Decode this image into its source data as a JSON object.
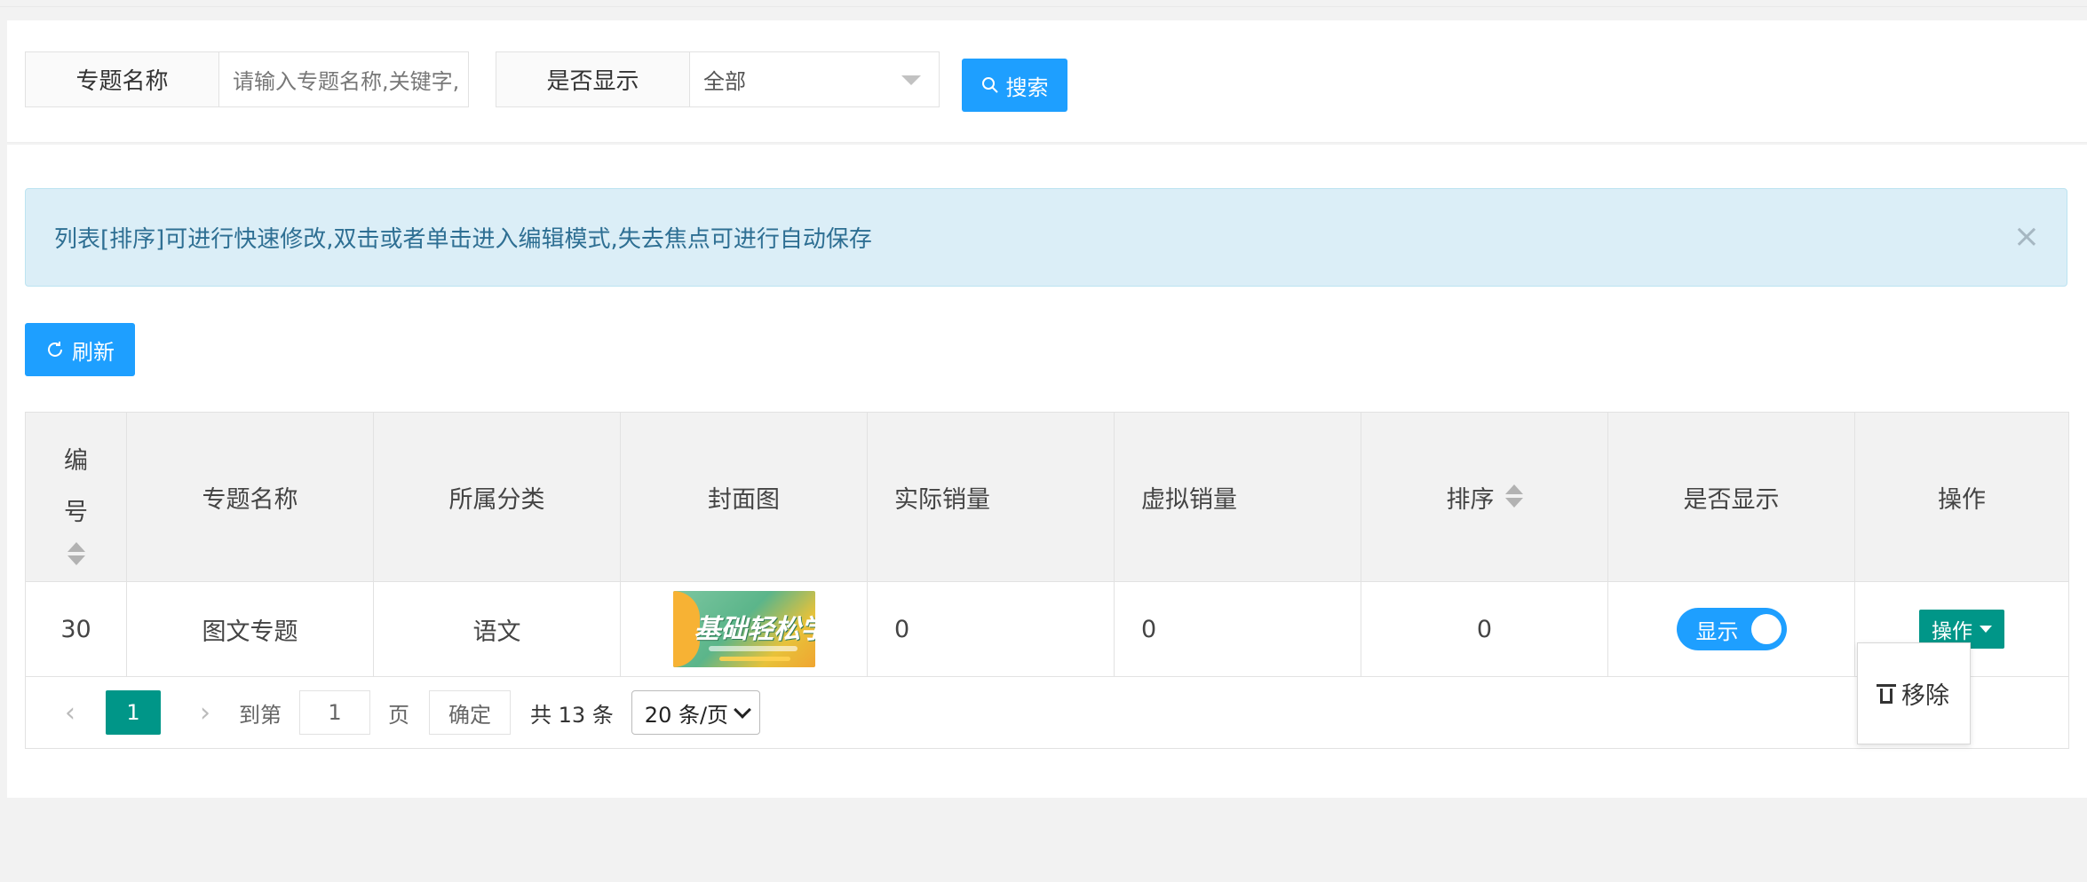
{
  "search": {
    "field1_label": "专题名称",
    "field1_placeholder": "请输入专题名称,关键字,",
    "field2_label": "是否显示",
    "field2_value": "全部",
    "search_button": "搜索"
  },
  "alert": {
    "text": "列表[排序]可进行快速修改,双击或者单击进入编辑模式,失去焦点可进行自动保存",
    "close": "×"
  },
  "toolbar": {
    "refresh_label": "刷新"
  },
  "table": {
    "headers": {
      "id_line1": "编",
      "id_line2": "号",
      "name": "专题名称",
      "category": "所属分类",
      "cover": "封面图",
      "actual_sales": "实际销量",
      "virtual_sales": "虚拟销量",
      "sort": "排序",
      "visible": "是否显示",
      "ops": "操作"
    },
    "rows": [
      {
        "id": "30",
        "name": "图文专题",
        "category": "语文",
        "cover_text": "基础轻松学",
        "actual_sales": "0",
        "virtual_sales": "0",
        "sort": "0",
        "visible_label": "显示",
        "ops_label": "操作"
      }
    ]
  },
  "pagination": {
    "current_page": "1",
    "goto_prefix": "到第",
    "goto_value": "1",
    "goto_suffix": "页",
    "confirm": "确定",
    "total": "共 13 条",
    "page_size": "20 条/页"
  },
  "popup": {
    "remove_label": "移除"
  },
  "colors": {
    "primary": "#1E9FFF",
    "green": "#009688",
    "alert_bg": "#dbeef7"
  }
}
